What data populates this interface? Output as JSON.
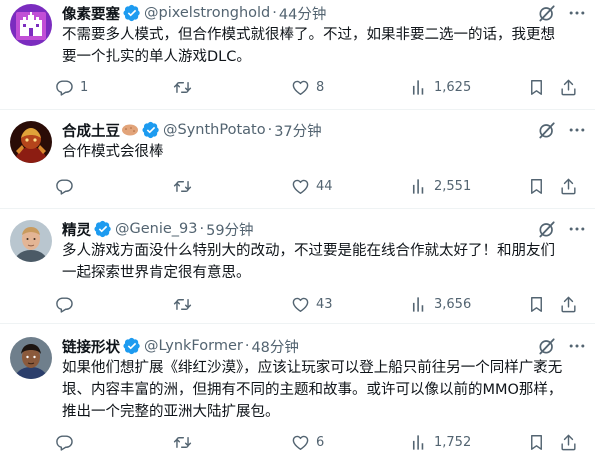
{
  "tweets": [
    {
      "name": "像素要塞",
      "handle": "@pixelstronghold",
      "dot": "·",
      "time": "44分钟",
      "lines": [
        "不需要多人模式，但合作模式就很棒了。不过，如果非要二选一的话，我更想",
        "要一个扎实的单人游戏DLC。"
      ],
      "replies": "1",
      "retweets": "",
      "likes": "8",
      "views": "1,625",
      "avatar": "castle-logo-avatar"
    },
    {
      "name": "合成土豆",
      "name_emoji": "potato-emoji",
      "handle": "@SynthPotato",
      "dot": "·",
      "time": "37分钟",
      "lines": [
        "合作模式会很棒"
      ],
      "replies": "",
      "retweets": "",
      "likes": "44",
      "views": "2,551",
      "avatar": "armored-character-avatar"
    },
    {
      "name": "精灵",
      "handle": "@Genie_93",
      "dot": "·",
      "time": "59分钟",
      "lines": [
        "多人游戏方面没什么特别大的改动，不过要是能在线合作就太好了！和朋友们",
        "一起探索世界肯定很有意思。"
      ],
      "replies": "",
      "retweets": "",
      "likes": "43",
      "views": "3,656",
      "avatar": "man-portrait-avatar"
    },
    {
      "name": "链接形状",
      "handle": "@LynkFormer",
      "dot": "·",
      "time": "48分钟",
      "lines": [
        "如果他们想扩展《绯红沙漠》，应该让玩家可以登上船只前往另一个同样广袤无",
        "垠、内容丰富的洲，但拥有不同的主题和故事。或许可以像以前的MMO那样，",
        "推出一个完整的亚洲大陆扩展包。"
      ],
      "replies": "",
      "retweets": "",
      "likes": "6",
      "views": "1,752",
      "avatar": "cartoon-character-avatar"
    }
  ],
  "colors": {
    "text": "#0f1419",
    "secondary": "#536471",
    "verified": "#1d9bf0",
    "divider": "#eff3f4"
  },
  "icons": [
    "verified-badge-icon",
    "grok-icon",
    "more-icon",
    "reply-icon",
    "retweet-icon",
    "like-icon",
    "views-icon",
    "bookmark-icon",
    "share-icon"
  ]
}
